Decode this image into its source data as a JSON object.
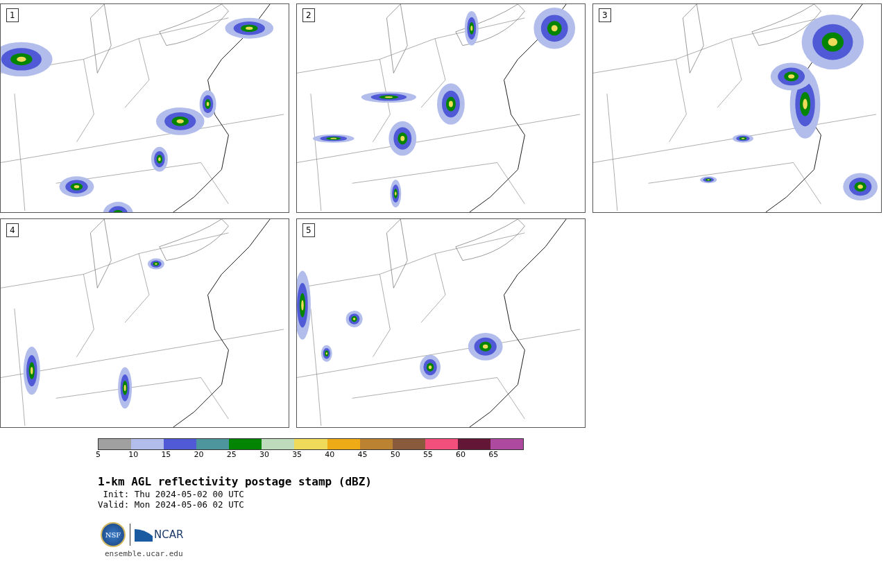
{
  "panels": [
    {
      "label": "1"
    },
    {
      "label": "2"
    },
    {
      "label": "3"
    },
    {
      "label": "4"
    },
    {
      "label": "5"
    }
  ],
  "colorbar": {
    "bins": [
      {
        "color": "#a0a0a0"
      },
      {
        "color": "#b3bdec"
      },
      {
        "color": "#505ad6"
      },
      {
        "color": "#4e969e"
      },
      {
        "color": "#038403"
      },
      {
        "color": "#bedcbc"
      },
      {
        "color": "#efda5a"
      },
      {
        "color": "#efab15"
      },
      {
        "color": "#bb8232"
      },
      {
        "color": "#8a5a3d"
      },
      {
        "color": "#f34f7c"
      },
      {
        "color": "#631635"
      },
      {
        "color": "#ad4aa0"
      }
    ],
    "ticks": [
      "5",
      "10",
      "15",
      "20",
      "25",
      "30",
      "35",
      "40",
      "45",
      "50",
      "55",
      "60",
      "65"
    ]
  },
  "title": "1-km AGL reflectivity postage stamp (dBZ)",
  "init": " Init: Thu 2024-05-02 00 UTC",
  "valid": "Valid: Mon 2024-05-06 02 UTC",
  "logo": {
    "nsf": "NSF",
    "ncar": "NCAR"
  },
  "url": "ensemble.ucar.edu"
}
